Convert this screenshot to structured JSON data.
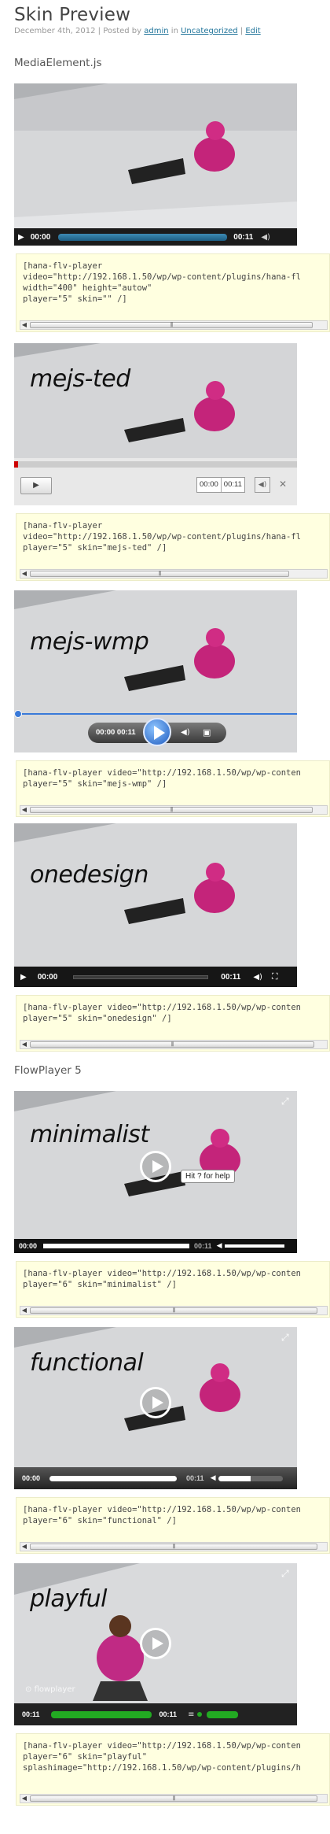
{
  "page": {
    "title": "Skin Preview",
    "meta": {
      "date": "December 4th, 2012",
      "posted_by": "| Posted by",
      "author": "admin",
      "in": "in",
      "category": "Uncategorized",
      "sep": "|",
      "edit": "Edit"
    }
  },
  "sections": {
    "mediaelement": "MediaElement.js",
    "flowplayer": "FlowPlayer 5"
  },
  "players": {
    "default": {
      "time_current": "00:00",
      "time_total": "00:11",
      "code": "[hana-flv-player\nvideo=\"http://192.168.1.50/wp/wp-content/plugins/hana-fl\nwidth=\"400\" height=\"autow\"\nplayer=\"5\" skin=\"\" /]"
    },
    "mejs_ted": {
      "label": "mejs-ted",
      "time_current": "00:00",
      "time_total": "00:11",
      "code": "[hana-flv-player\nvideo=\"http://192.168.1.50/wp/wp-content/plugins/hana-fl\nplayer=\"5\" skin=\"mejs-ted\" /]"
    },
    "mejs_wmp": {
      "label": "mejs-wmp",
      "time": "00:00 00:11",
      "code": "[hana-flv-player video=\"http://192.168.1.50/wp/wp-conten\nplayer=\"5\" skin=\"mejs-wmp\" /]"
    },
    "onedesign": {
      "label": "onedesign",
      "time_current": "00:00",
      "time_total": "00:11",
      "code": "[hana-flv-player video=\"http://192.168.1.50/wp/wp-conten\nplayer=\"5\" skin=\"onedesign\" /]"
    },
    "minimalist": {
      "label": "minimalist",
      "time_current": "00:00",
      "time_total": "00:11",
      "tooltip": "Hit ? for help",
      "code": "[hana-flv-player video=\"http://192.168.1.50/wp/wp-conten\nplayer=\"6\" skin=\"minimalist\" /]"
    },
    "functional": {
      "label": "functional",
      "time_current": "00:00",
      "time_total": "00:11",
      "code": "[hana-flv-player video=\"http://192.168.1.50/wp/wp-conten\nplayer=\"6\" skin=\"functional\" /]"
    },
    "playful": {
      "label": "playful",
      "time_current": "00:11",
      "time_total": "00:11",
      "watermark": "flowplayer",
      "code": "[hana-flv-player video=\"http://192.168.1.50/wp/wp-conten\nplayer=\"6\" skin=\"playful\"\nsplashimage=\"http://192.168.1.50/wp/wp-content/plugins/h"
    }
  },
  "colors": {
    "link": "#21759b",
    "code_bg": "#ffffe0",
    "playful_bar": "#22aa22",
    "wmp_blue": "#3a7ad9"
  }
}
